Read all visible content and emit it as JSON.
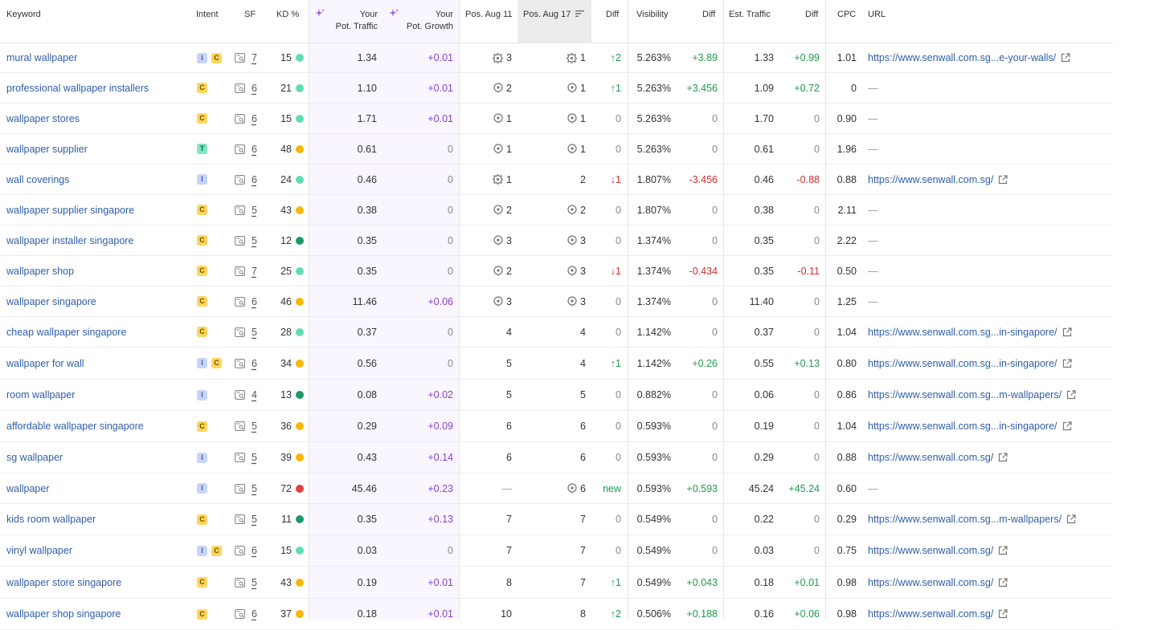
{
  "headers": {
    "keyword": "Keyword",
    "intent": "Intent",
    "sf": "SF",
    "kd": "KD %",
    "pot_traffic_line1": "Your",
    "pot_traffic_line2": "Pot. Traffic",
    "pot_growth_line1": "Your",
    "pot_growth_line2": "Pot. Growth",
    "pos1": "Pos. Aug 11",
    "pos2": "Pos. Aug 17",
    "diff": "Diff",
    "visibility": "Visibility",
    "vis_diff": "Diff",
    "est_traffic": "Est. Traffic",
    "traffic_diff": "Diff",
    "cpc": "CPC",
    "url": "URL"
  },
  "colors": {
    "kd_easy": "#5fdcb5",
    "kd_very_easy": "#1a9b65",
    "kd_medium": "#f5b700",
    "kd_hard": "#e43f3f",
    "link": "#2f5ea8",
    "purple": "#8a3ed0",
    "green": "#1f9a4b",
    "red": "#d12d2d"
  },
  "rows": [
    {
      "keyword": "mural wallpaper",
      "intents": [
        "I",
        "C"
      ],
      "sf": "7",
      "kd": "15",
      "kd_color": "#5fdcb5",
      "pot_traffic": "1.34",
      "pot_growth": "+0.01",
      "pos1_icon": "sitelinks-icon",
      "pos1": "3",
      "pos2_icon": "sitelinks-icon",
      "pos2": "1",
      "diff": "↑2",
      "diff_class": "green",
      "visibility": "5.263%",
      "vis_diff": "+3.89",
      "vis_diff_class": "green",
      "est_traffic": "1.33",
      "traffic_diff": "+0.99",
      "traffic_diff_class": "green",
      "cpc": "1.01",
      "url": "https://www.senwall.com.sg...e-your-walls/",
      "has_url": true
    },
    {
      "keyword": "professional wallpaper installers",
      "intents": [
        "C"
      ],
      "sf": "6",
      "kd": "21",
      "kd_color": "#5fdcb5",
      "pot_traffic": "1.10",
      "pot_growth": "+0.01",
      "pos1_icon": "local-pack-icon",
      "pos1": "2",
      "pos2_icon": "local-pack-icon",
      "pos2": "1",
      "diff": "↑1",
      "diff_class": "green",
      "visibility": "5.263%",
      "vis_diff": "+3.456",
      "vis_diff_class": "green",
      "est_traffic": "1.09",
      "traffic_diff": "+0.72",
      "traffic_diff_class": "green",
      "cpc": "0",
      "url": "—",
      "has_url": false
    },
    {
      "keyword": "wallpaper stores",
      "intents": [
        "C"
      ],
      "sf": "6",
      "kd": "15",
      "kd_color": "#5fdcb5",
      "pot_traffic": "1.71",
      "pot_growth": "+0.01",
      "pos1_icon": "local-pack-icon",
      "pos1": "1",
      "pos2_icon": "local-pack-icon",
      "pos2": "1",
      "diff": "0",
      "diff_class": "gray",
      "visibility": "5.263%",
      "vis_diff": "0",
      "vis_diff_class": "gray",
      "est_traffic": "1.70",
      "traffic_diff": "0",
      "traffic_diff_class": "gray",
      "cpc": "0.90",
      "url": "—",
      "has_url": false
    },
    {
      "keyword": "wallpaper supplier",
      "intents": [
        "T"
      ],
      "sf": "6",
      "kd": "48",
      "kd_color": "#f5b700",
      "pot_traffic": "0.61",
      "pot_growth": "0",
      "pos1_icon": "local-pack-icon",
      "pos1": "1",
      "pos2_icon": "local-pack-icon",
      "pos2": "1",
      "diff": "0",
      "diff_class": "gray",
      "visibility": "5.263%",
      "vis_diff": "0",
      "vis_diff_class": "gray",
      "est_traffic": "0.61",
      "traffic_diff": "0",
      "traffic_diff_class": "gray",
      "cpc": "1.96",
      "url": "—",
      "has_url": false
    },
    {
      "keyword": "wall coverings",
      "intents": [
        "I"
      ],
      "sf": "6",
      "kd": "24",
      "kd_color": "#5fdcb5",
      "pot_traffic": "0.46",
      "pot_growth": "0",
      "pos1_icon": "sitelinks-icon",
      "pos1": "1",
      "pos2_icon": "",
      "pos2": "2",
      "diff": "↓1",
      "diff_class": "red",
      "visibility": "1.807%",
      "vis_diff": "-3.456",
      "vis_diff_class": "red",
      "est_traffic": "0.46",
      "traffic_diff": "-0.88",
      "traffic_diff_class": "red",
      "cpc": "0.88",
      "url": "https://www.senwall.com.sg/",
      "has_url": true
    },
    {
      "keyword": "wallpaper supplier singapore",
      "intents": [
        "C"
      ],
      "sf": "5",
      "kd": "43",
      "kd_color": "#f5b700",
      "pot_traffic": "0.38",
      "pot_growth": "0",
      "pos1_icon": "local-pack-icon",
      "pos1": "2",
      "pos2_icon": "local-pack-icon",
      "pos2": "2",
      "diff": "0",
      "diff_class": "gray",
      "visibility": "1.807%",
      "vis_diff": "0",
      "vis_diff_class": "gray",
      "est_traffic": "0.38",
      "traffic_diff": "0",
      "traffic_diff_class": "gray",
      "cpc": "2.11",
      "url": "—",
      "has_url": false
    },
    {
      "keyword": "wallpaper installer singapore",
      "intents": [
        "C"
      ],
      "sf": "5",
      "kd": "12",
      "kd_color": "#1a9b65",
      "pot_traffic": "0.35",
      "pot_growth": "0",
      "pos1_icon": "local-pack-icon",
      "pos1": "3",
      "pos2_icon": "local-pack-icon",
      "pos2": "3",
      "diff": "0",
      "diff_class": "gray",
      "visibility": "1.374%",
      "vis_diff": "0",
      "vis_diff_class": "gray",
      "est_traffic": "0.35",
      "traffic_diff": "0",
      "traffic_diff_class": "gray",
      "cpc": "2.22",
      "url": "—",
      "has_url": false
    },
    {
      "keyword": "wallpaper shop",
      "intents": [
        "C"
      ],
      "sf": "7",
      "kd": "25",
      "kd_color": "#5fdcb5",
      "pot_traffic": "0.35",
      "pot_growth": "0",
      "pos1_icon": "local-pack-icon",
      "pos1": "2",
      "pos2_icon": "local-pack-icon",
      "pos2": "3",
      "diff": "↓1",
      "diff_class": "red",
      "visibility": "1.374%",
      "vis_diff": "-0.434",
      "vis_diff_class": "red",
      "est_traffic": "0.35",
      "traffic_diff": "-0.11",
      "traffic_diff_class": "red",
      "cpc": "0.50",
      "url": "—",
      "has_url": false
    },
    {
      "keyword": "wallpaper singapore",
      "intents": [
        "C"
      ],
      "sf": "6",
      "kd": "46",
      "kd_color": "#f5b700",
      "pot_traffic": "11.46",
      "pot_growth": "+0.06",
      "pos1_icon": "local-pack-icon",
      "pos1": "3",
      "pos2_icon": "local-pack-icon",
      "pos2": "3",
      "diff": "0",
      "diff_class": "gray",
      "visibility": "1.374%",
      "vis_diff": "0",
      "vis_diff_class": "gray",
      "est_traffic": "11.40",
      "traffic_diff": "0",
      "traffic_diff_class": "gray",
      "cpc": "1.25",
      "url": "—",
      "has_url": false
    },
    {
      "keyword": "cheap wallpaper singapore",
      "intents": [
        "C"
      ],
      "sf": "5",
      "kd": "28",
      "kd_color": "#5fdcb5",
      "pot_traffic": "0.37",
      "pot_growth": "0",
      "pos1_icon": "",
      "pos1": "4",
      "pos2_icon": "",
      "pos2": "4",
      "diff": "0",
      "diff_class": "gray",
      "visibility": "1.142%",
      "vis_diff": "0",
      "vis_diff_class": "gray",
      "est_traffic": "0.37",
      "traffic_diff": "0",
      "traffic_diff_class": "gray",
      "cpc": "1.04",
      "url": "https://www.senwall.com.sg...in-singapore/",
      "has_url": true
    },
    {
      "keyword": "wallpaper for wall",
      "intents": [
        "I",
        "C"
      ],
      "sf": "6",
      "kd": "34",
      "kd_color": "#f5b700",
      "pot_traffic": "0.56",
      "pot_growth": "0",
      "pos1_icon": "",
      "pos1": "5",
      "pos2_icon": "",
      "pos2": "4",
      "diff": "↑1",
      "diff_class": "green",
      "visibility": "1.142%",
      "vis_diff": "+0.26",
      "vis_diff_class": "green",
      "est_traffic": "0.55",
      "traffic_diff": "+0.13",
      "traffic_diff_class": "green",
      "cpc": "0.80",
      "url": "https://www.senwall.com.sg...in-singapore/",
      "has_url": true
    },
    {
      "keyword": "room wallpaper",
      "intents": [
        "I"
      ],
      "sf": "4",
      "kd": "13",
      "kd_color": "#1a9b65",
      "pot_traffic": "0.08",
      "pot_growth": "+0.02",
      "pos1_icon": "",
      "pos1": "5",
      "pos2_icon": "",
      "pos2": "5",
      "diff": "0",
      "diff_class": "gray",
      "visibility": "0.882%",
      "vis_diff": "0",
      "vis_diff_class": "gray",
      "est_traffic": "0.06",
      "traffic_diff": "0",
      "traffic_diff_class": "gray",
      "cpc": "0.86",
      "url": "https://www.senwall.com.sg...m-wallpapers/",
      "has_url": true
    },
    {
      "keyword": "affordable wallpaper singapore",
      "intents": [
        "C"
      ],
      "sf": "5",
      "kd": "36",
      "kd_color": "#f5b700",
      "pot_traffic": "0.29",
      "pot_growth": "+0.09",
      "pos1_icon": "",
      "pos1": "6",
      "pos2_icon": "",
      "pos2": "6",
      "diff": "0",
      "diff_class": "gray",
      "visibility": "0.593%",
      "vis_diff": "0",
      "vis_diff_class": "gray",
      "est_traffic": "0.19",
      "traffic_diff": "0",
      "traffic_diff_class": "gray",
      "cpc": "1.04",
      "url": "https://www.senwall.com.sg...in-singapore/",
      "has_url": true
    },
    {
      "keyword": "sg wallpaper",
      "intents": [
        "I"
      ],
      "sf": "5",
      "kd": "39",
      "kd_color": "#f5b700",
      "pot_traffic": "0.43",
      "pot_growth": "+0.14",
      "pos1_icon": "",
      "pos1": "6",
      "pos2_icon": "",
      "pos2": "6",
      "diff": "0",
      "diff_class": "gray",
      "visibility": "0.593%",
      "vis_diff": "0",
      "vis_diff_class": "gray",
      "est_traffic": "0.29",
      "traffic_diff": "0",
      "traffic_diff_class": "gray",
      "cpc": "0.88",
      "url": "https://www.senwall.com.sg/",
      "has_url": true
    },
    {
      "keyword": "wallpaper",
      "intents": [
        "I"
      ],
      "sf": "5",
      "kd": "72",
      "kd_color": "#e43f3f",
      "pot_traffic": "45.46",
      "pot_growth": "+0.23",
      "pos1_icon": "",
      "pos1": "—",
      "pos2_icon": "local-pack-icon",
      "pos2": "6",
      "diff": "new",
      "diff_class": "green",
      "visibility": "0.593%",
      "vis_diff": "+0.593",
      "vis_diff_class": "green",
      "est_traffic": "45.24",
      "traffic_diff": "+45.24",
      "traffic_diff_class": "green",
      "cpc": "0.60",
      "url": "—",
      "has_url": false
    },
    {
      "keyword": "kids room wallpaper",
      "intents": [
        "C"
      ],
      "sf": "5",
      "kd": "11",
      "kd_color": "#1a9b65",
      "pot_traffic": "0.35",
      "pot_growth": "+0.13",
      "pos1_icon": "",
      "pos1": "7",
      "pos2_icon": "",
      "pos2": "7",
      "diff": "0",
      "diff_class": "gray",
      "visibility": "0.549%",
      "vis_diff": "0",
      "vis_diff_class": "gray",
      "est_traffic": "0.22",
      "traffic_diff": "0",
      "traffic_diff_class": "gray",
      "cpc": "0.29",
      "url": "https://www.senwall.com.sg...m-wallpapers/",
      "has_url": true
    },
    {
      "keyword": "vinyl wallpaper",
      "intents": [
        "I",
        "C"
      ],
      "sf": "6",
      "kd": "15",
      "kd_color": "#5fdcb5",
      "pot_traffic": "0.03",
      "pot_growth": "0",
      "pos1_icon": "",
      "pos1": "7",
      "pos2_icon": "",
      "pos2": "7",
      "diff": "0",
      "diff_class": "gray",
      "visibility": "0.549%",
      "vis_diff": "0",
      "vis_diff_class": "gray",
      "est_traffic": "0.03",
      "traffic_diff": "0",
      "traffic_diff_class": "gray",
      "cpc": "0.75",
      "url": "https://www.senwall.com.sg/",
      "has_url": true
    },
    {
      "keyword": "wallpaper store singapore",
      "intents": [
        "C"
      ],
      "sf": "5",
      "kd": "43",
      "kd_color": "#f5b700",
      "pot_traffic": "0.19",
      "pot_growth": "+0.01",
      "pos1_icon": "",
      "pos1": "8",
      "pos2_icon": "",
      "pos2": "7",
      "diff": "↑1",
      "diff_class": "green",
      "visibility": "0.549%",
      "vis_diff": "+0.043",
      "vis_diff_class": "green",
      "est_traffic": "0.18",
      "traffic_diff": "+0.01",
      "traffic_diff_class": "green",
      "cpc": "0.98",
      "url": "https://www.senwall.com.sg/",
      "has_url": true
    },
    {
      "keyword": "wallpaper shop singapore",
      "intents": [
        "C"
      ],
      "sf": "6",
      "kd": "37",
      "kd_color": "#f5b700",
      "pot_traffic": "0.18",
      "pot_growth": "+0.01",
      "pos1_icon": "",
      "pos1": "10",
      "pos2_icon": "",
      "pos2": "8",
      "diff": "↑2",
      "diff_class": "green",
      "visibility": "0.506%",
      "vis_diff": "+0.188",
      "vis_diff_class": "green",
      "est_traffic": "0.16",
      "traffic_diff": "+0.06",
      "traffic_diff_class": "green",
      "cpc": "0.98",
      "url": "https://www.senwall.com.sg/",
      "has_url": true
    }
  ]
}
